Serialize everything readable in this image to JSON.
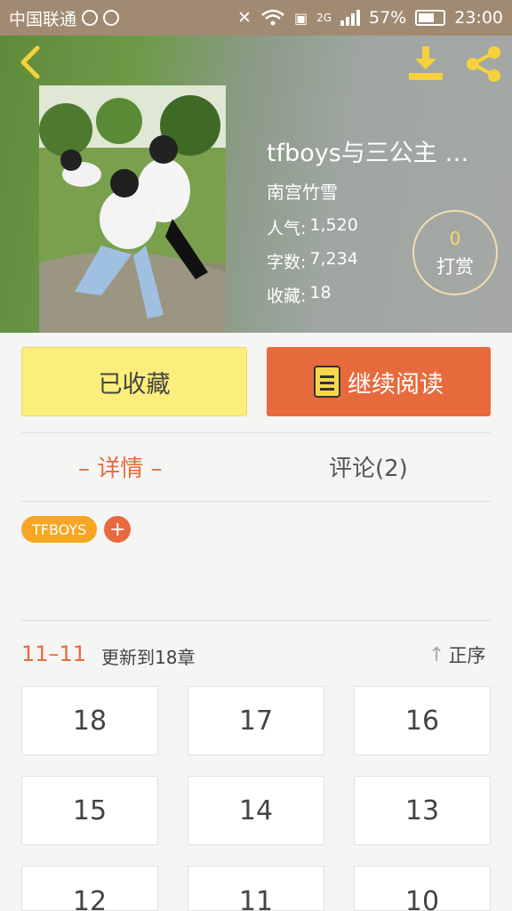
{
  "status_bar": {
    "carrier": "中国联通",
    "network": "2G",
    "battery": "57%",
    "time": "23:00"
  },
  "header": {
    "title": "tfboys与三公主 …",
    "author": "南宫竹雪",
    "popularity_label": "人气:",
    "popularity_value": "1,520",
    "words_label": "字数:",
    "words_value": "7,234",
    "favorites_label": "收藏:",
    "favorites_value": "18",
    "tip_count": "0",
    "tip_label": "打赏"
  },
  "actions": {
    "collect_label": "已收藏",
    "read_label": "继续阅读"
  },
  "tabs": {
    "detail_label": "– 详情 –",
    "comment_label": "评论(2)"
  },
  "tags": [
    {
      "label": "TFBOYS"
    }
  ],
  "chapters": {
    "range": "11–11",
    "update_text": "更新到18章",
    "sort_label": "正序",
    "items": [
      "18",
      "17",
      "16",
      "15",
      "14",
      "13",
      "12",
      "11",
      "10"
    ]
  },
  "colors": {
    "accent": "#e76a3d",
    "collect_bg": "#fbee7c",
    "tag_bg": "#f6a623"
  }
}
